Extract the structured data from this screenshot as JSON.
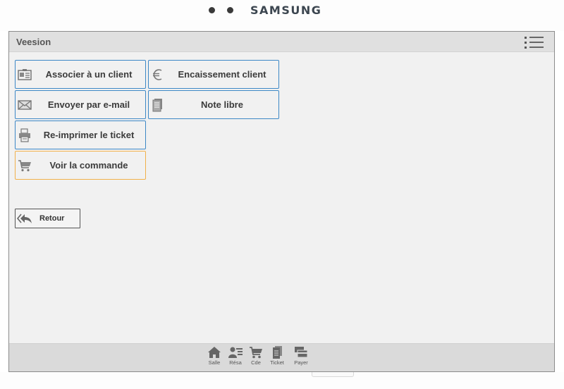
{
  "device": {
    "brand": "SAMSUNG"
  },
  "app": {
    "title": "Veesion"
  },
  "actions": [
    {
      "label": "Associer à un client",
      "icon": "contact-card-icon"
    },
    {
      "label": "Encaissement client",
      "icon": "euro-icon"
    },
    {
      "label": "Envoyer par e-mail",
      "icon": "envelope-icon"
    },
    {
      "label": "Note libre",
      "icon": "note-icon"
    },
    {
      "label": "Re-imprimer le ticket",
      "icon": "printer-icon"
    },
    {
      "label": "Voir la commande",
      "icon": "cart-icon"
    }
  ],
  "back_button": {
    "label": "Retour",
    "icon": "reply-all-icon"
  },
  "bottom_nav": [
    {
      "label": "Salle",
      "icon": "home-icon"
    },
    {
      "label": "Résa",
      "icon": "reservation-icon"
    },
    {
      "label": "Cde",
      "icon": "cart-icon"
    },
    {
      "label": "Ticket",
      "icon": "ticket-icon"
    },
    {
      "label": "Payer",
      "icon": "payment-icon"
    }
  ],
  "colors": {
    "button_border": "#3d88c6",
    "highlight_border": "#f1b04a",
    "screen_bg": "#f1f1f1"
  }
}
